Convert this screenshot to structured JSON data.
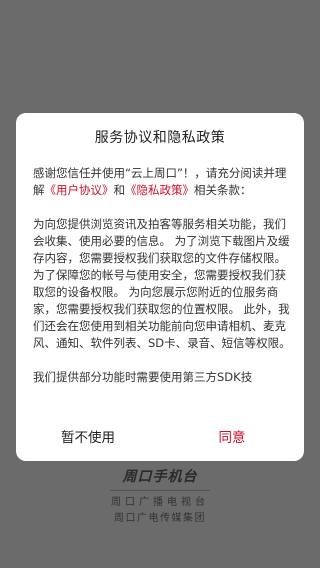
{
  "dialog": {
    "title": "服务协议和隐私政策",
    "intro_before": "感谢您信任并使用“云上周口”！，请充分阅读并理解",
    "user_agreement_link": "《用户协议》",
    "intro_and": "和",
    "privacy_policy_link": "《隐私政策》",
    "intro_after": "相关条款：",
    "paragraph_2": "为向您提供浏览资讯及拍客等服务相关功能，我们会收集、使用必要的信息。 为了浏览下载图片及缓存内容，您需要授权我们获取您的文件存储权限。 为了保障您的帐号与使用安全，您需要授权我们获取您的设备权限。 为向您展示您附近的位服务商家，您需要授权我们获取您的位置权限。 此外，我们还会在您使用到相关功能前向您申请相机、麦克风、通知、软件列表、SD卡、录音、短信等权限。",
    "paragraph_3": "我们提供部分功能时需要使用第三方SDK技",
    "decline_label": "暂不使用",
    "accept_label": "同意"
  },
  "brand": {
    "logo_text": "周口手机台",
    "line1": "周口广播电视台",
    "line2": "周口广电传媒集团"
  },
  "colors": {
    "overlay": "#6b6b6b",
    "accent": "#c8102e",
    "dialog_bg": "#ffffff"
  }
}
